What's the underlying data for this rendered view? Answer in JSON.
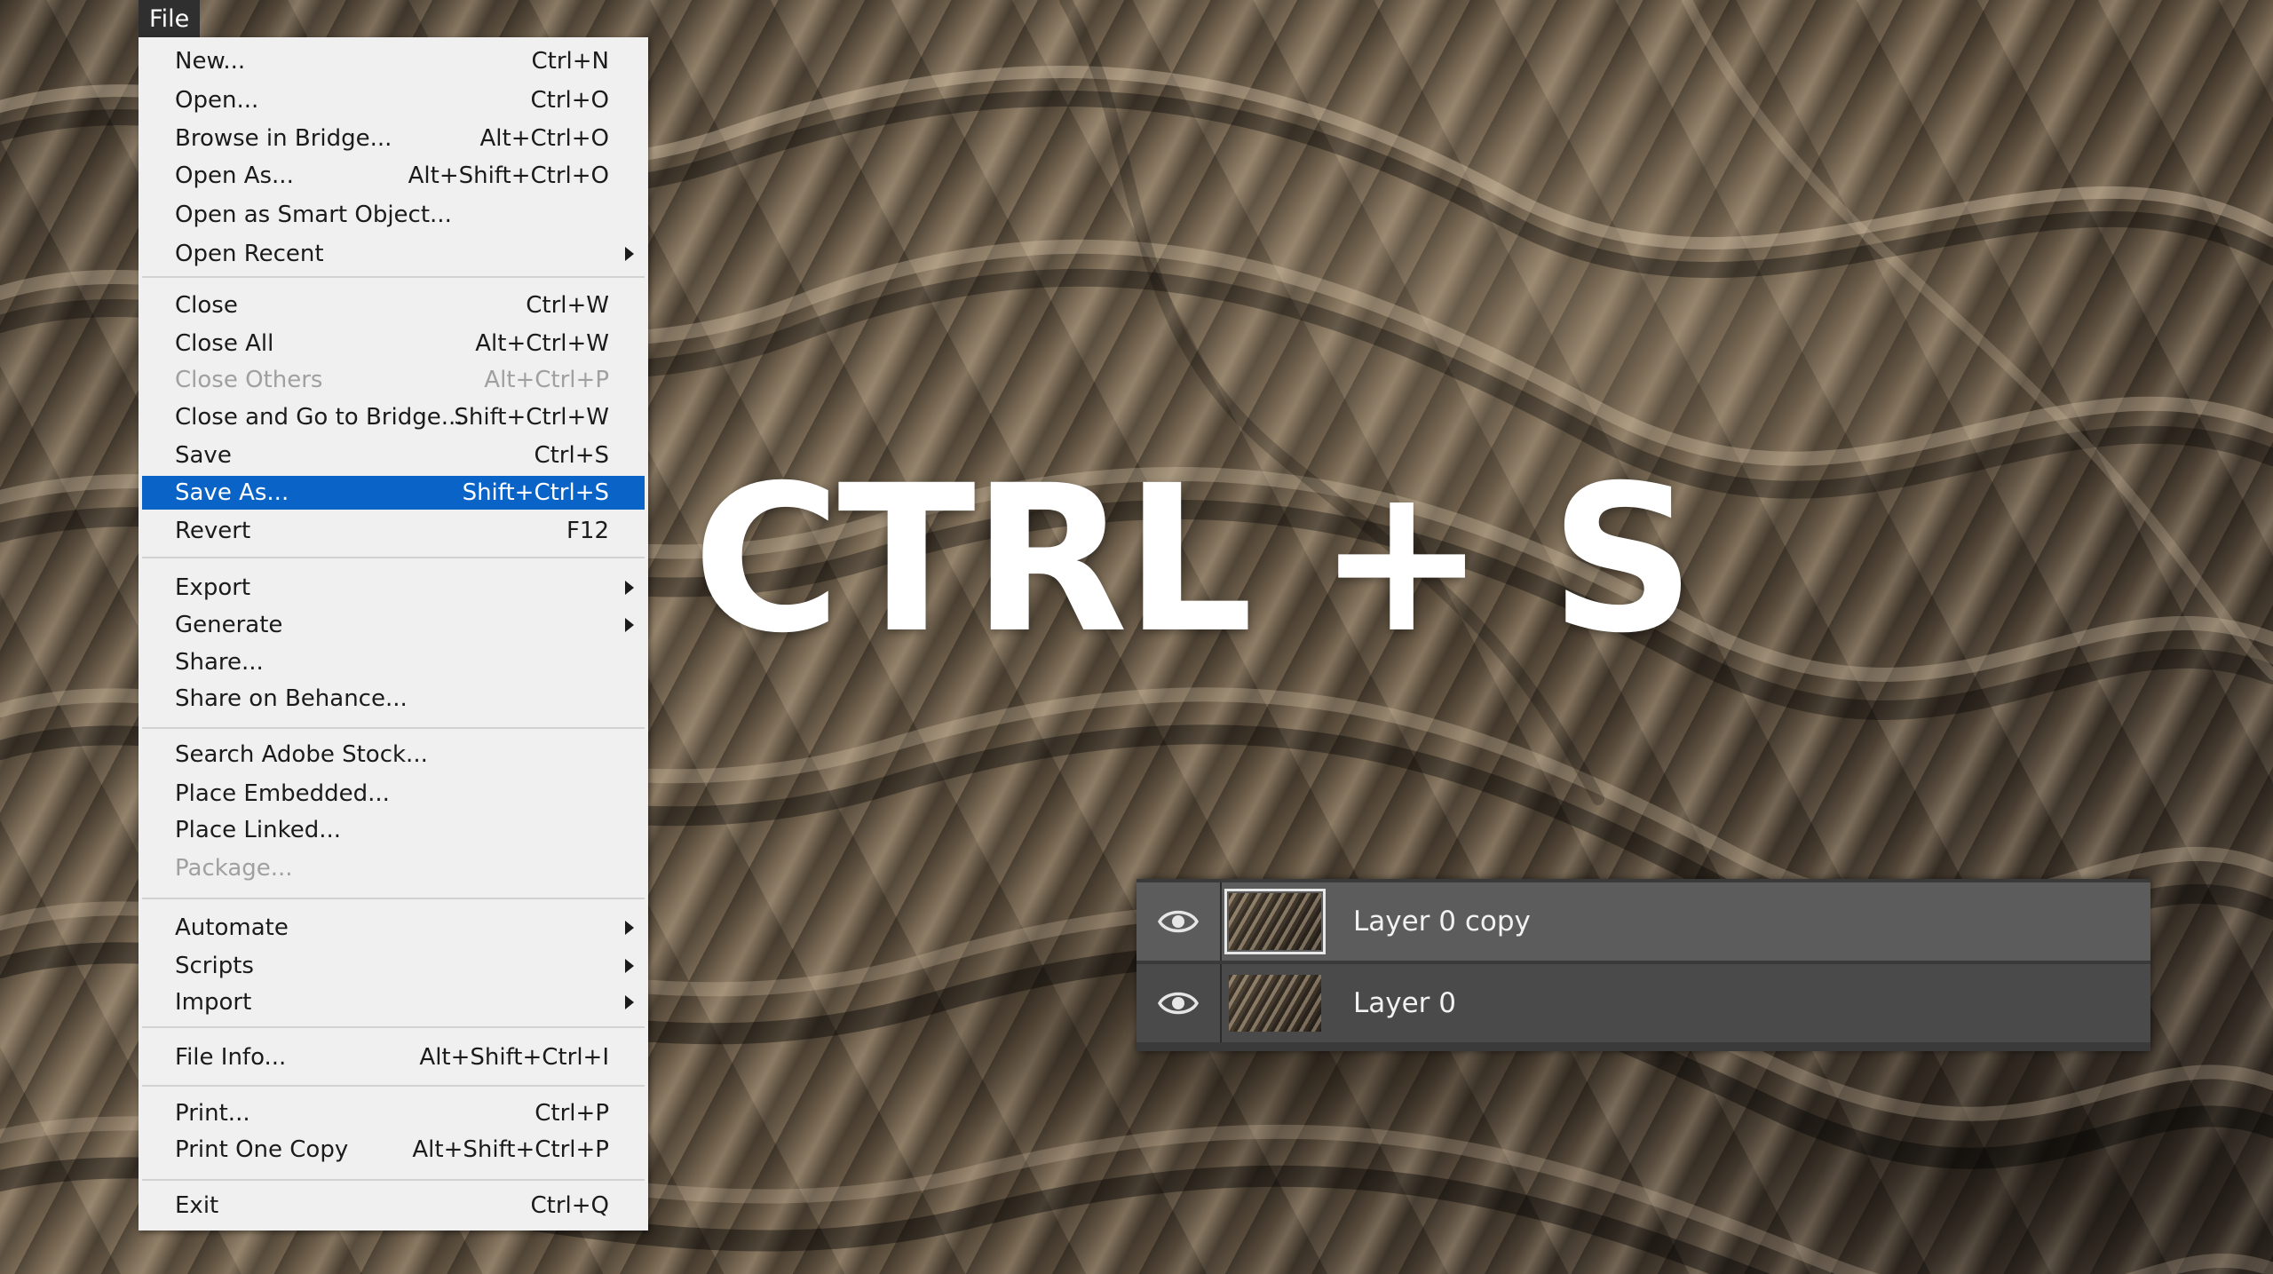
{
  "menubar": {
    "file_label": "File"
  },
  "file_menu": {
    "items": [
      {
        "label": "New...",
        "shortcut": "Ctrl+N"
      },
      {
        "label": "Open...",
        "shortcut": "Ctrl+O"
      },
      {
        "label": "Browse in Bridge...",
        "shortcut": "Alt+Ctrl+O"
      },
      {
        "label": "Open As...",
        "shortcut": "Alt+Shift+Ctrl+O"
      },
      {
        "label": "Open as Smart Object...",
        "shortcut": ""
      },
      {
        "label": "Open Recent",
        "shortcut": ""
      },
      {
        "label": "Close",
        "shortcut": "Ctrl+W"
      },
      {
        "label": "Close All",
        "shortcut": "Alt+Ctrl+W"
      },
      {
        "label": "Close Others",
        "shortcut": "Alt+Ctrl+P"
      },
      {
        "label": "Close and Go to Bridge...",
        "shortcut": "Shift+Ctrl+W"
      },
      {
        "label": "Save",
        "shortcut": "Ctrl+S"
      },
      {
        "label": "Save As...",
        "shortcut": "Shift+Ctrl+S"
      },
      {
        "label": "Revert",
        "shortcut": "F12"
      },
      {
        "label": "Export",
        "shortcut": ""
      },
      {
        "label": "Generate",
        "shortcut": ""
      },
      {
        "label": "Share...",
        "shortcut": ""
      },
      {
        "label": "Share on Behance...",
        "shortcut": ""
      },
      {
        "label": "Search Adobe Stock...",
        "shortcut": ""
      },
      {
        "label": "Place Embedded...",
        "shortcut": ""
      },
      {
        "label": "Place Linked...",
        "shortcut": ""
      },
      {
        "label": "Package...",
        "shortcut": ""
      },
      {
        "label": "Automate",
        "shortcut": ""
      },
      {
        "label": "Scripts",
        "shortcut": ""
      },
      {
        "label": "Import",
        "shortcut": ""
      },
      {
        "label": "File Info...",
        "shortcut": "Alt+Shift+Ctrl+I"
      },
      {
        "label": "Print...",
        "shortcut": "Ctrl+P"
      },
      {
        "label": "Print One Copy",
        "shortcut": "Alt+Shift+Ctrl+P"
      },
      {
        "label": "Exit",
        "shortcut": "Ctrl+Q"
      }
    ],
    "highlight_color": "#0a64c8",
    "disabled_color": "#a0a0a0"
  },
  "overlay": {
    "shortcut_text": "CTRL + S"
  },
  "layers": {
    "rows": [
      {
        "name": "Layer 0 copy",
        "icon": "eye-icon"
      },
      {
        "name": "Layer 0",
        "icon": "eye-icon"
      }
    ]
  }
}
